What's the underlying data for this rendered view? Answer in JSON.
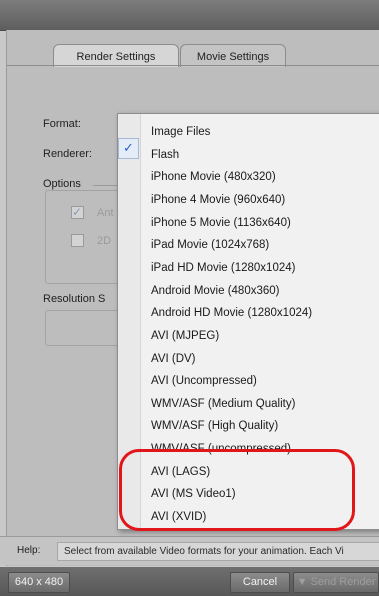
{
  "tabs": [
    "Render Settings",
    "Movie Settings"
  ],
  "labels": {
    "format": "Format:",
    "renderer": "Renderer:",
    "options": "Options",
    "option1_partial": "Ant",
    "option2_partial": "2D",
    "resolution": "Resolution S"
  },
  "menu": {
    "selected": "Flash",
    "items": [
      "Image Files",
      "Flash",
      "iPhone Movie (480x320)",
      "iPhone 4 Movie (960x640)",
      "iPhone 5 Movie (1136x640)",
      "iPad Movie (1024x768)",
      "iPad HD Movie (1280x1024)",
      "Android Movie (480x360)",
      "Android HD Movie (1280x1024)",
      "AVI (MJPEG)",
      "AVI (DV)",
      "AVI (Uncompressed)",
      "WMV/ASF (Medium Quality)",
      "WMV/ASF (High Quality)",
      "WMV/ASF (uncompressed)",
      "AVI (LAGS)",
      "AVI (MS Video1)",
      "AVI (XVID)"
    ]
  },
  "help": {
    "label": "Help:",
    "text": "Select from available Video formats for your animation. Each Vi"
  },
  "footer": {
    "size": "640 x 480",
    "cancel": "Cancel",
    "send_render": "Send Render"
  },
  "colors": {
    "highlight_ring": "#e0161b",
    "check": "#2b64c8"
  }
}
